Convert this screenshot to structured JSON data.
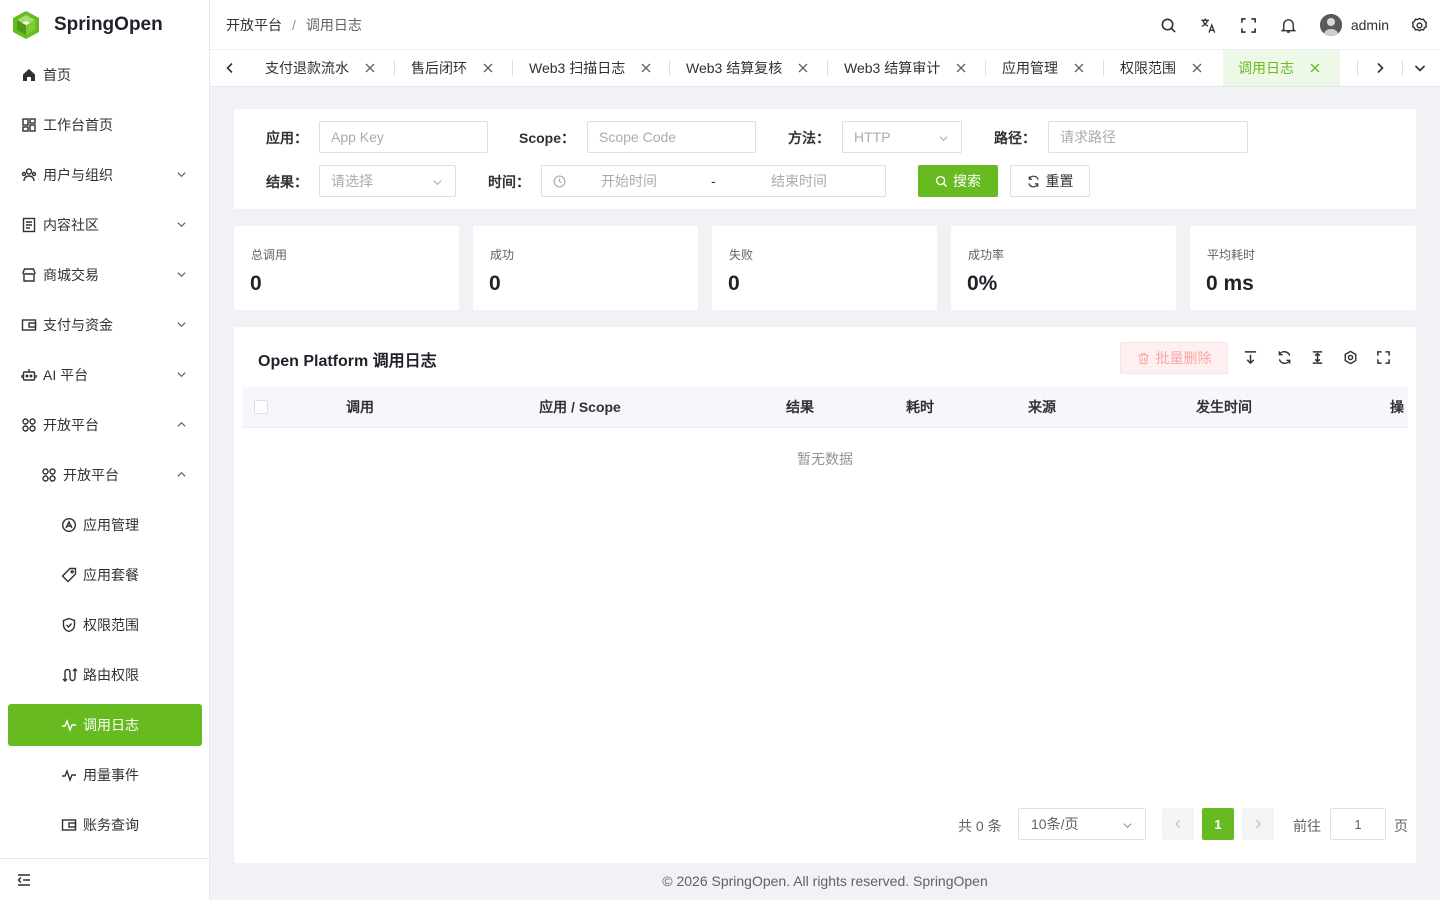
{
  "brand": {
    "name": "SpringOpen",
    "color": "#67ba1f"
  },
  "sidebar": {
    "items": [
      {
        "label": "首页",
        "icon": "home-icon"
      },
      {
        "label": "工作台首页",
        "icon": "dashboard-icon"
      },
      {
        "label": "用户与组织",
        "icon": "users-icon",
        "expanded": false
      },
      {
        "label": "内容社区",
        "icon": "document-icon",
        "expanded": false
      },
      {
        "label": "商城交易",
        "icon": "shop-icon",
        "expanded": false
      },
      {
        "label": "支付与资金",
        "icon": "wallet-icon",
        "expanded": false
      },
      {
        "label": "AI 平台",
        "icon": "robot-icon",
        "expanded": false
      },
      {
        "label": "开放平台",
        "icon": "grid-icon",
        "expanded": true
      }
    ],
    "sub_group": {
      "label": "开放平台",
      "icon": "grid-icon",
      "expanded": true
    },
    "sub_items": [
      {
        "label": "应用管理",
        "icon": "app-icon"
      },
      {
        "label": "应用套餐",
        "icon": "tag-icon"
      },
      {
        "label": "权限范围",
        "icon": "shield-icon"
      },
      {
        "label": "路由权限",
        "icon": "route-icon"
      },
      {
        "label": "调用日志",
        "icon": "activity-icon",
        "active": true
      },
      {
        "label": "用量事件",
        "icon": "activity-icon"
      },
      {
        "label": "账务查询",
        "icon": "wallet-icon"
      }
    ]
  },
  "header": {
    "breadcrumb": [
      "开放平台",
      "调用日志"
    ],
    "breadcrumb_separator": "/",
    "username": "admin"
  },
  "tabs": [
    {
      "label": "支付退款流水"
    },
    {
      "label": "售后闭环"
    },
    {
      "label": "Web3 扫描日志"
    },
    {
      "label": "Web3 结算复核"
    },
    {
      "label": "Web3 结算审计"
    },
    {
      "label": "应用管理"
    },
    {
      "label": "权限范围"
    },
    {
      "label": "调用日志",
      "active": true
    }
  ],
  "filters": {
    "app_label": "应用：",
    "app_placeholder": "App Key",
    "scope_label": "Scope：",
    "scope_placeholder": "Scope Code",
    "method_label": "方法：",
    "method_value": "HTTP",
    "path_label": "路径：",
    "path_placeholder": "请求路径",
    "result_label": "结果：",
    "result_placeholder": "请选择",
    "time_label": "时间：",
    "time_start_placeholder": "开始时间",
    "time_separator": "-",
    "time_end_placeholder": "结束时间",
    "search_label": "搜索",
    "reset_label": "重置"
  },
  "stats": [
    {
      "label": "总调用",
      "value": "0"
    },
    {
      "label": "成功",
      "value": "0"
    },
    {
      "label": "失败",
      "value": "0"
    },
    {
      "label": "成功率",
      "value": "0%"
    },
    {
      "label": "平均耗时",
      "value": "0 ms"
    }
  ],
  "table": {
    "title": "Open Platform 调用日志",
    "batch_delete_label": "批量删除",
    "columns": [
      "调用",
      "应用 / Scope",
      "结果",
      "耗时",
      "来源",
      "发生时间",
      "操"
    ],
    "empty_text": "暂无数据"
  },
  "pagination": {
    "total_text": "共 0 条",
    "page_size": "10条/页",
    "current_page": "1",
    "goto_label": "前往",
    "goto_value": "1",
    "page_suffix": "页"
  },
  "footer": {
    "text": "© 2026 SpringOpen. All rights reserved. SpringOpen"
  }
}
